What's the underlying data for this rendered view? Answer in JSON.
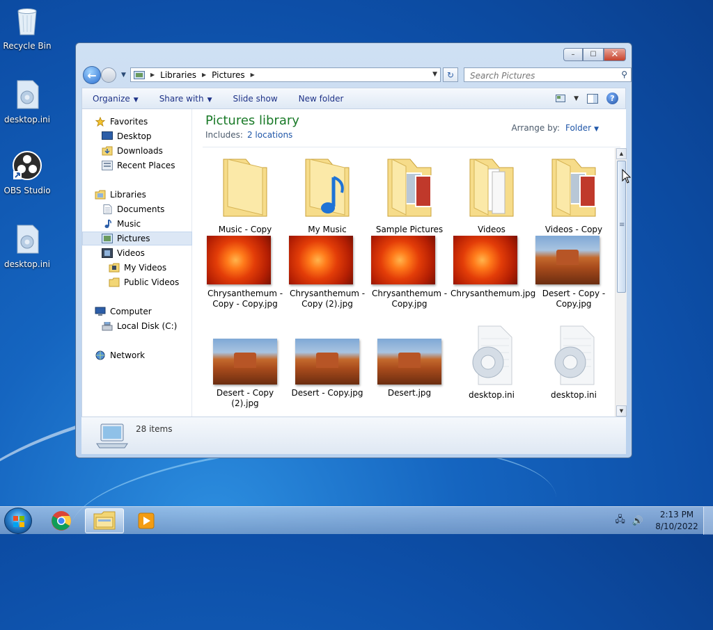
{
  "desktop": {
    "icons": [
      {
        "label": "Recycle Bin"
      },
      {
        "label": "desktop.ini"
      },
      {
        "label": "OBS Studio"
      },
      {
        "label": "desktop.ini"
      }
    ]
  },
  "window": {
    "controls": {
      "minimize": "–",
      "maximize": "☐",
      "close": "✕"
    },
    "address": {
      "crumbs": [
        "Libraries",
        "Pictures"
      ]
    },
    "search": {
      "placeholder": "Search Pictures"
    },
    "toolbar": {
      "organize": "Organize",
      "share_with": "Share with",
      "slide_show": "Slide show",
      "new_folder": "New folder"
    },
    "nav": {
      "favorites": {
        "label": "Favorites",
        "items": [
          "Desktop",
          "Downloads",
          "Recent Places"
        ]
      },
      "libraries": {
        "label": "Libraries",
        "items": [
          "Documents",
          "Music",
          "Pictures",
          "Videos"
        ],
        "videos_children": [
          "My Videos",
          "Public Videos"
        ]
      },
      "computer": {
        "label": "Computer",
        "items": [
          "Local Disk (C:)"
        ]
      },
      "network": {
        "label": "Network"
      }
    },
    "library": {
      "title": "Pictures library",
      "includes_label": "Includes:",
      "includes_link": "2 locations",
      "arrange_label": "Arrange by:",
      "arrange_value": "Folder"
    },
    "items": [
      {
        "name": "Music - Copy",
        "kind": "folder"
      },
      {
        "name": "My Music",
        "kind": "folder-music"
      },
      {
        "name": "Sample Pictures",
        "kind": "folder-photos"
      },
      {
        "name": "Videos",
        "kind": "folder-docs"
      },
      {
        "name": "Videos - Copy",
        "kind": "folder-photos"
      },
      {
        "name": "Chrysanthemum - Copy - Copy.jpg",
        "kind": "chrysanthemum"
      },
      {
        "name": "Chrysanthemum - Copy (2).jpg",
        "kind": "chrysanthemum"
      },
      {
        "name": "Chrysanthemum - Copy.jpg",
        "kind": "chrysanthemum"
      },
      {
        "name": "Chrysanthemum.jpg",
        "kind": "chrysanthemum"
      },
      {
        "name": "Desert - Copy - Copy.jpg",
        "kind": "desert"
      },
      {
        "name": "Desert - Copy (2).jpg",
        "kind": "desert"
      },
      {
        "name": "Desert - Copy.jpg",
        "kind": "desert"
      },
      {
        "name": "Desert.jpg",
        "kind": "desert"
      },
      {
        "name": "desktop.ini",
        "kind": "settings-file"
      },
      {
        "name": "desktop.ini",
        "kind": "settings-file"
      }
    ],
    "details": {
      "item_count": "28 items"
    }
  },
  "taskbar": {
    "clock": {
      "time": "2:13 PM",
      "date": "8/10/2022"
    }
  }
}
